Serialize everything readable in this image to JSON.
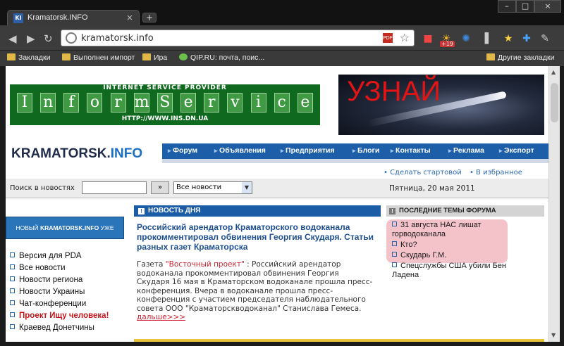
{
  "browser": {
    "tab_title": "Kramatorsk.INFO",
    "tab_favicon_text": "KI",
    "tab_close": "×",
    "new_tab": "+",
    "window_buttons": {
      "minimize": "–",
      "maximize": "□",
      "close": "×"
    },
    "nav": {
      "back": "◀",
      "forward": "▶",
      "reload": "↻"
    },
    "address": "kramatorsk.info",
    "extension_badge": "+19",
    "bookmarks": [
      {
        "label": "Закладки"
      },
      {
        "label": "Выполнен импорт"
      },
      {
        "label": "Ира"
      },
      {
        "label": "QIP.RU: почта, поис..."
      },
      {
        "label": "Другие закладки"
      }
    ]
  },
  "page": {
    "banner_inform": {
      "top_text": "INTERNET SERVICE PROVIDER",
      "letters": [
        "I",
        "n",
        "f",
        "o",
        "r",
        "m",
        "S",
        "e",
        "r",
        "v",
        "i",
        "c",
        "e"
      ],
      "bottom_text": "HTTP://WWW.INS.DN.UA"
    },
    "banner_ad_text": "УЗНАЙ",
    "logo": {
      "main": "KRAMATORSK.",
      "accent": "INFO"
    },
    "nav": [
      "Форум",
      "Объявления",
      "Предприятия",
      "Блоги",
      "Контакты",
      "Реклама",
      "Экспорт"
    ],
    "quicklinks": [
      "• Сделать стартовой",
      "• В избранное"
    ],
    "search": {
      "label": "Поиск в новостях",
      "value": "",
      "go": "»",
      "scope": "Все новости",
      "date": "Пятница, 20 мая 2011"
    },
    "promo": {
      "prefix": "НОВЫЙ ",
      "name": "KRAMATORSK.INFO",
      "suffix": " УЖЕ РЯДОМ"
    },
    "left_menu": [
      {
        "label": "Версия для PDA"
      },
      {
        "label": "Все новости"
      },
      {
        "label": "Новости региона"
      },
      {
        "label": "Новости Украины"
      },
      {
        "label": "Чат-конференции"
      },
      {
        "label": "Проект Ищу человека!"
      },
      {
        "label": "Краевед Донетчины"
      }
    ],
    "news": {
      "section_title": "НОВОСТЬ ДНЯ",
      "headline": "Российский арендатор Краматорского водоканала прокомментировал обвинения Георгия Скударя. Статьи разных газет Краматорска",
      "source_prefix": "Газета ",
      "source": "\"Восточный проект\"",
      "body": " : Российский арендатор водоканала прокомментировал обвинения Георгия Скударя 16 мая в Краматорском водоканале прошла пресс-конференция. Вчера в водоканале прошла пресс-конференция с участием председателя наблюдательного совета ООО \"Краматорскводоканал\" Станислава Гемеса. ",
      "more": "дальше>>>"
    },
    "forum": {
      "section_title": "ПОСЛЕДНИЕ ТЕМЫ ФОРУМА",
      "items": [
        "31 августа НАС лишат горводоканала",
        "Кто?",
        "Скударь Г.М.",
        "Спецслужбы США убили Бен Ладена"
      ]
    }
  },
  "colors": {
    "nav_blue": "#1c5ea8",
    "accent_red": "#c2161b",
    "forum_highlight": "#f2b8bf"
  }
}
